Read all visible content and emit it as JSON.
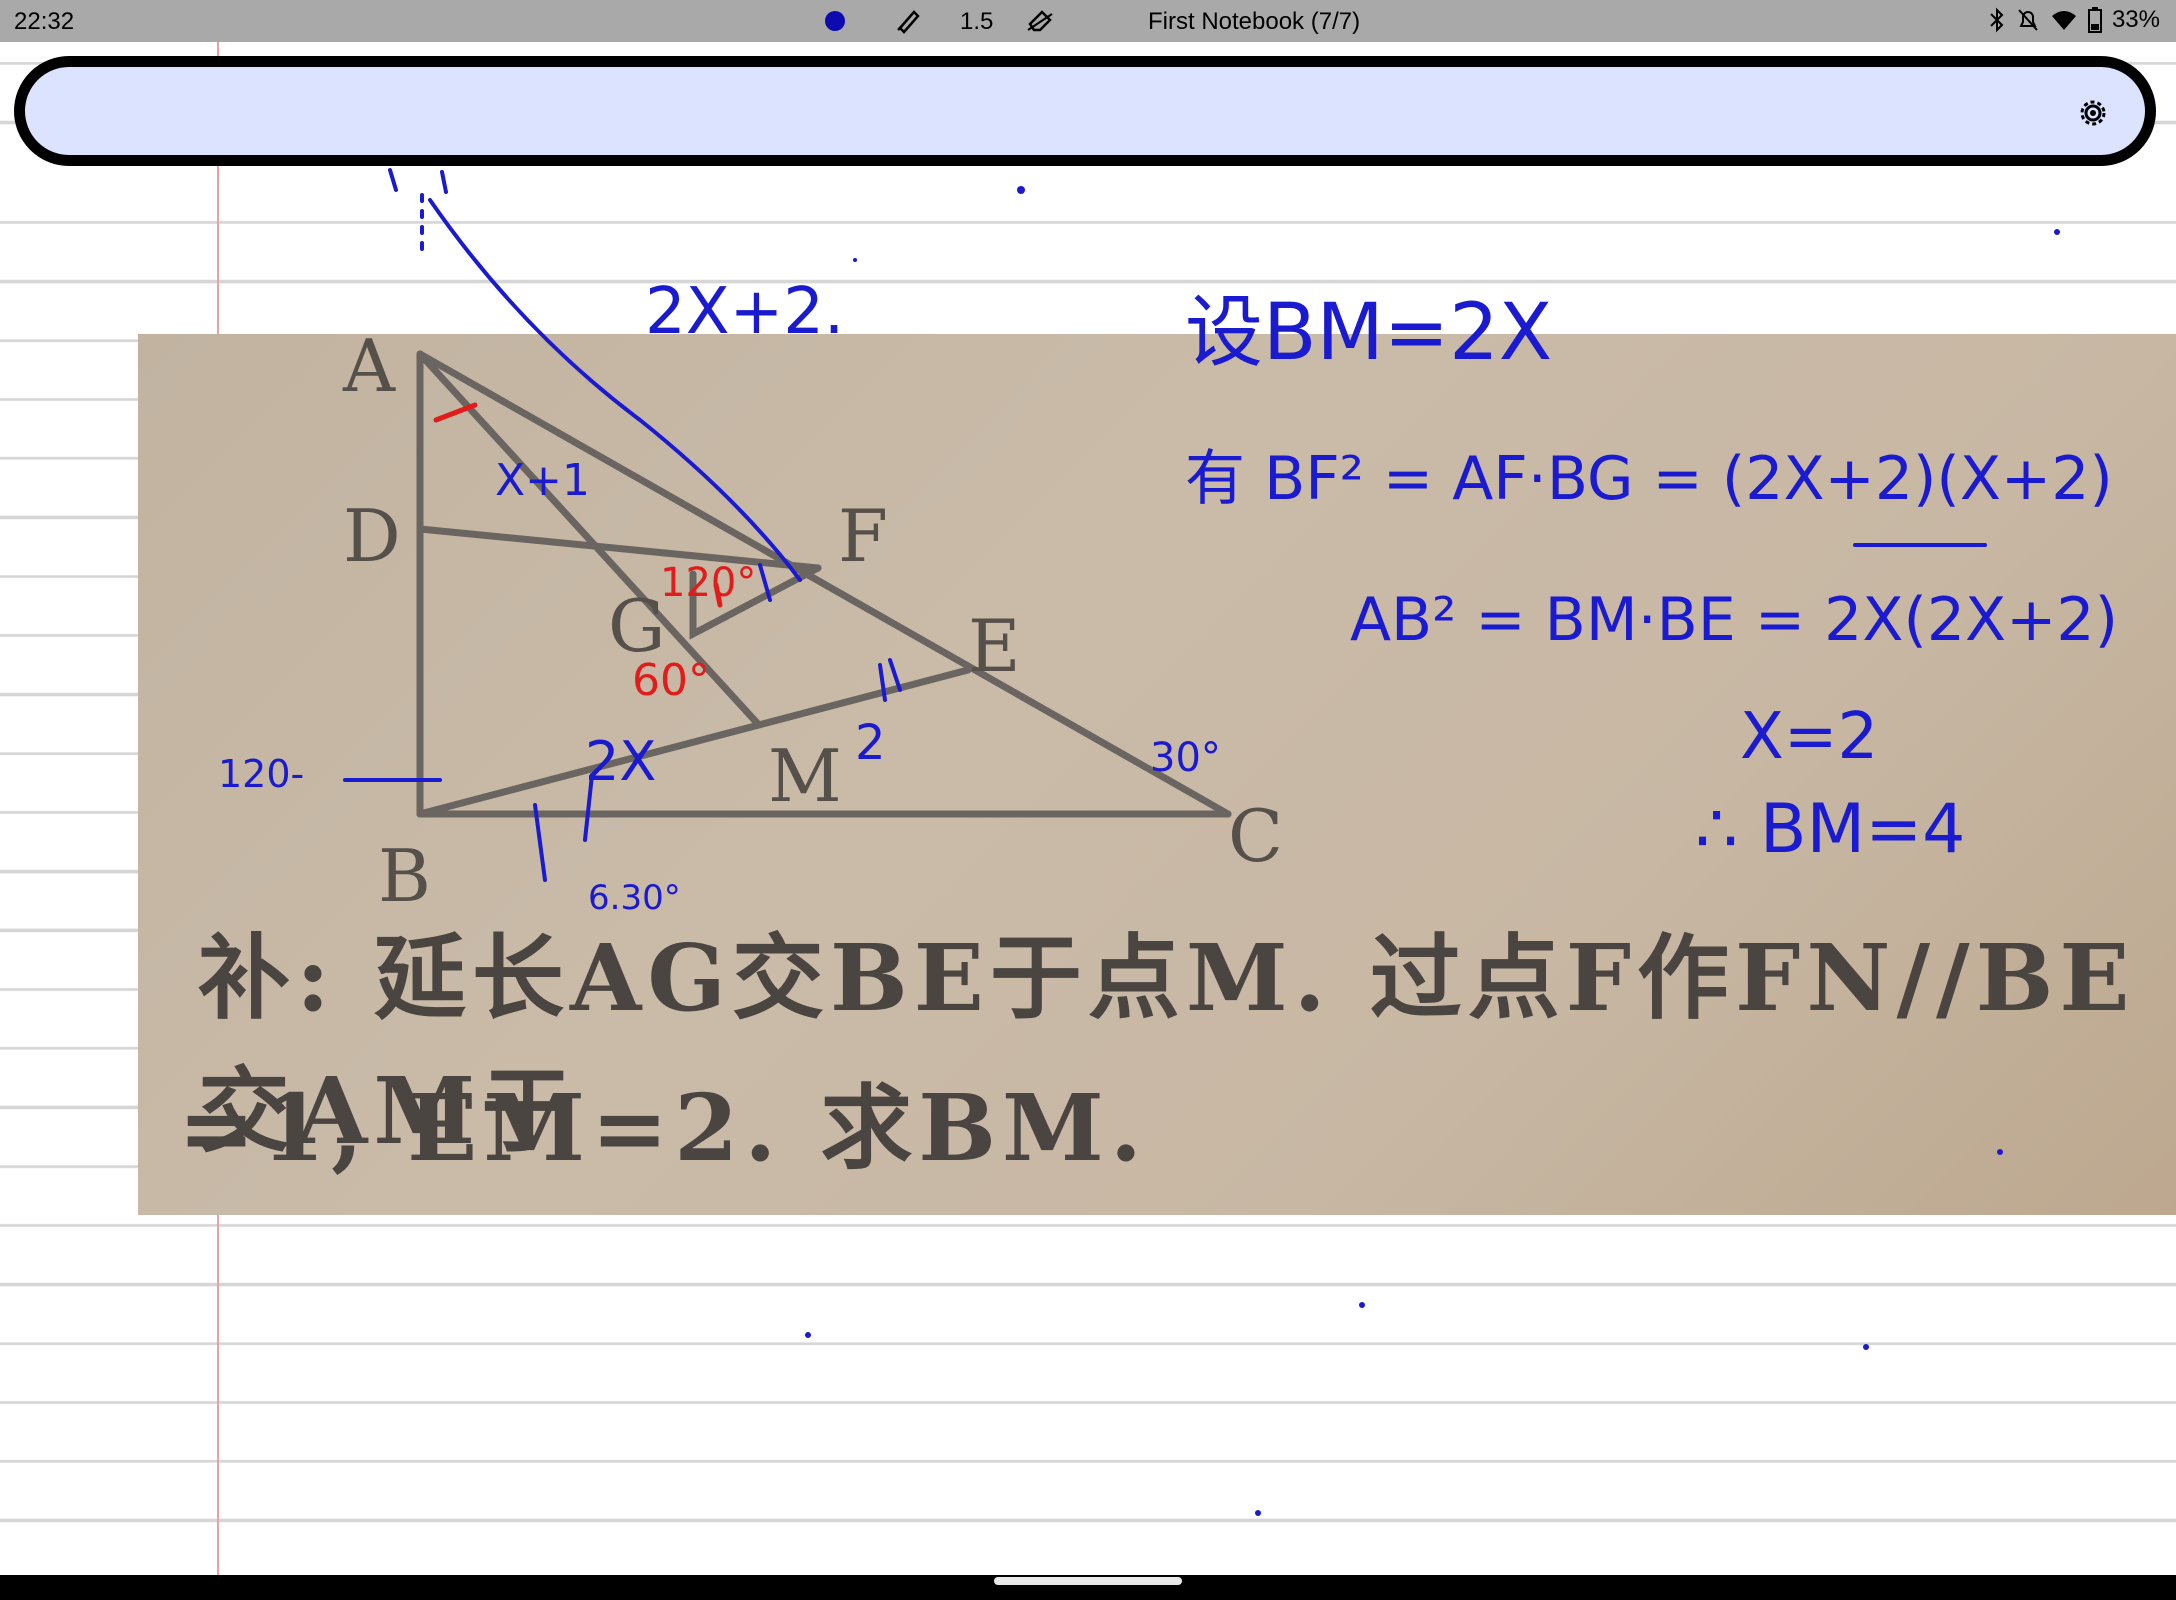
{
  "status_bar": {
    "time": "22:32",
    "pen_width": "1.5",
    "notebook_title": "First Notebook (7/7)",
    "battery": "33%"
  },
  "colors": {
    "ink_blue": "#1a1ad0",
    "ink_red": "#e21b1b",
    "toolbar_bg": "#dbe3ff",
    "status_bg": "#a9a9a9"
  },
  "photo": {
    "point_labels": [
      "A",
      "D",
      "G",
      "F",
      "E",
      "M",
      "B",
      "C"
    ],
    "problem_line1": "补: 延长AG交BE于点M. 过点F作FN//BE交AM于",
    "problem_line2": "=1, EM=2. 求BM."
  },
  "handwriting": {
    "top_expr": "2X+2.",
    "assume": "设BM=2X",
    "eq1": "有 BF² = AF·BG = (2X+2)(X+2)",
    "eq2": "AB² = BM·BE = 2X(2X+2)",
    "x_value": "X=2",
    "conclusion": "∴ BM=4",
    "x_plus_1": "X+1",
    "label_2x": "2X",
    "label_2": "2",
    "label_120": "120°",
    "label_60": "60°",
    "label_30": "30°",
    "label_130": "120-",
    "label_630": "6.30°"
  }
}
